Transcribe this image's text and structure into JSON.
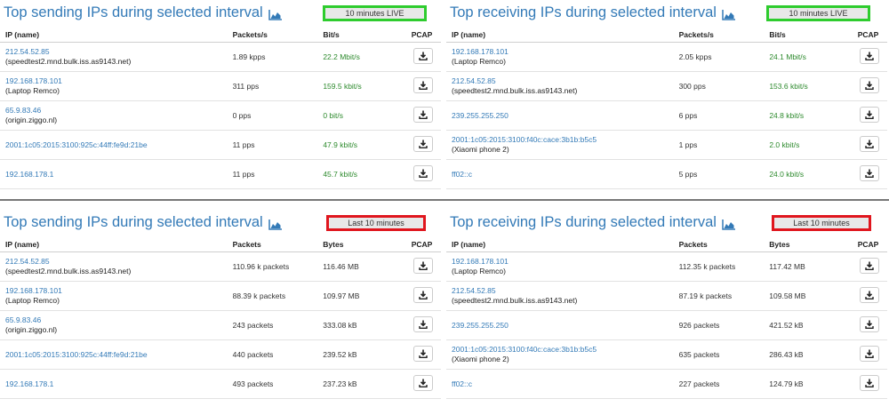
{
  "colors": {
    "link": "#337ab7",
    "rate": "#2d8a2d",
    "live_border": "#2ecc2e",
    "last_border": "#e0161e"
  },
  "panels": [
    {
      "title": "Top sending IPs during selected interval",
      "badge": "10 minutes LIVE",
      "columns": [
        "IP (name)",
        "Packets/s",
        "Bit/s",
        "PCAP"
      ],
      "rows": [
        {
          "ip": "212.54.52.85",
          "name": "(speedtest2.mnd.bulk.iss.as9143.net)",
          "c1": "1.89 kpps",
          "c2": "22.2 Mbit/s"
        },
        {
          "ip": "192.168.178.101",
          "name": "(Laptop Remco)",
          "c1": "311 pps",
          "c2": "159.5 kbit/s"
        },
        {
          "ip": "65.9.83.46",
          "name": "(origin.ziggo.nl)",
          "c1": "0 pps",
          "c2": "0 bit/s"
        },
        {
          "ip": "2001:1c05:2015:3100:925c:44ff:fe9d:21be",
          "name": "",
          "c1": "11 pps",
          "c2": "47.9 kbit/s"
        },
        {
          "ip": "192.168.178.1",
          "name": "",
          "c1": "11 pps",
          "c2": "45.7 kbit/s"
        }
      ]
    },
    {
      "title": "Top receiving IPs during selected interval",
      "badge": "10 minutes LIVE",
      "columns": [
        "IP (name)",
        "Packets/s",
        "Bit/s",
        "PCAP"
      ],
      "rows": [
        {
          "ip": "192.168.178.101",
          "name": "(Laptop Remco)",
          "c1": "2.05 kpps",
          "c2": "24.1 Mbit/s"
        },
        {
          "ip": "212.54.52.85",
          "name": "(speedtest2.mnd.bulk.iss.as9143.net)",
          "c1": "300 pps",
          "c2": "153.6 kbit/s"
        },
        {
          "ip": "239.255.255.250",
          "name": "",
          "c1": "6 pps",
          "c2": "24.8 kbit/s"
        },
        {
          "ip": "2001:1c05:2015:3100:f40c:cace:3b1b:b5c5",
          "name": "(Xiaomi phone 2)",
          "c1": "1 pps",
          "c2": "2.0 kbit/s"
        },
        {
          "ip": "ff02::c",
          "name": "",
          "c1": "5 pps",
          "c2": "24.0 kbit/s"
        }
      ]
    },
    {
      "title": "Top sending IPs during selected interval",
      "badge": "Last 10 minutes",
      "columns": [
        "IP (name)",
        "Packets",
        "Bytes",
        "PCAP"
      ],
      "rows": [
        {
          "ip": "212.54.52.85",
          "name": "(speedtest2.mnd.bulk.iss.as9143.net)",
          "c1": "110.96 k packets",
          "c2": "116.46 MB"
        },
        {
          "ip": "192.168.178.101",
          "name": "(Laptop Remco)",
          "c1": "88.39 k packets",
          "c2": "109.97 MB"
        },
        {
          "ip": "65.9.83.46",
          "name": "(origin.ziggo.nl)",
          "c1": "243 packets",
          "c2": "333.08 kB"
        },
        {
          "ip": "2001:1c05:2015:3100:925c:44ff:fe9d:21be",
          "name": "",
          "c1": "440 packets",
          "c2": "239.52 kB"
        },
        {
          "ip": "192.168.178.1",
          "name": "",
          "c1": "493 packets",
          "c2": "237.23 kB"
        }
      ]
    },
    {
      "title": "Top receiving IPs during selected interval",
      "badge": "Last 10 minutes",
      "columns": [
        "IP (name)",
        "Packets",
        "Bytes",
        "PCAP"
      ],
      "rows": [
        {
          "ip": "192.168.178.101",
          "name": "(Laptop Remco)",
          "c1": "112.35 k packets",
          "c2": "117.42 MB"
        },
        {
          "ip": "212.54.52.85",
          "name": "(speedtest2.mnd.bulk.iss.as9143.net)",
          "c1": "87.19 k packets",
          "c2": "109.58 MB"
        },
        {
          "ip": "239.255.255.250",
          "name": "",
          "c1": "926 packets",
          "c2": "421.52 kB"
        },
        {
          "ip": "2001:1c05:2015:3100:f40c:cace:3b1b:b5c5",
          "name": "(Xiaomi phone 2)",
          "c1": "635 packets",
          "c2": "286.43 kB"
        },
        {
          "ip": "ff02::c",
          "name": "",
          "c1": "227 packets",
          "c2": "124.79 kB"
        }
      ]
    }
  ]
}
